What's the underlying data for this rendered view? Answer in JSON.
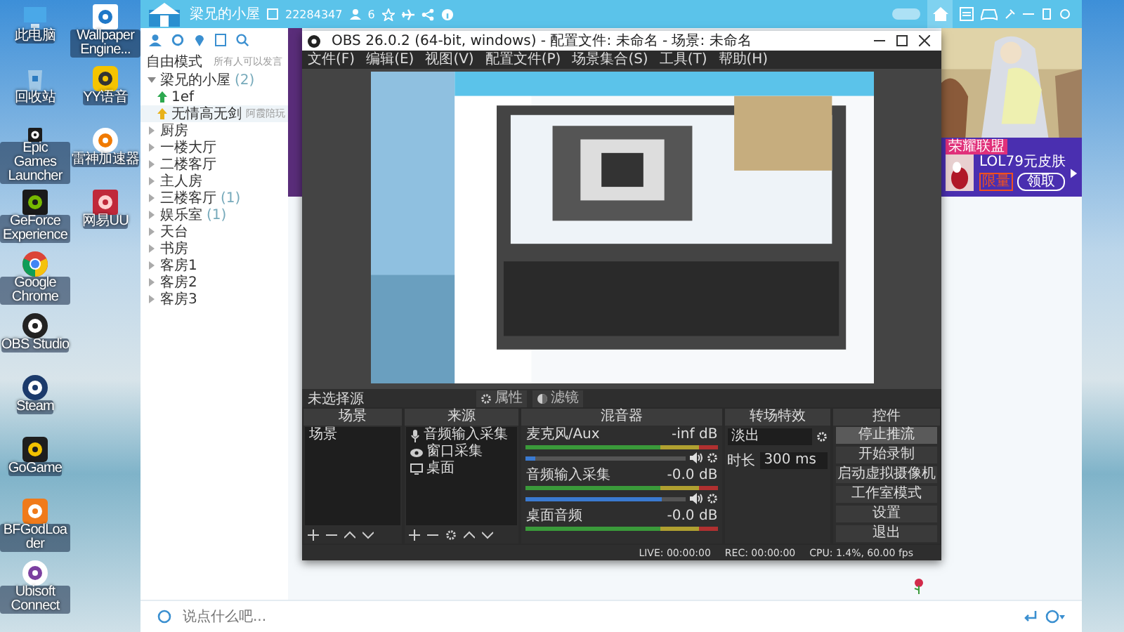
{
  "desktop": {
    "columns": [
      [
        {
          "kind": "pc",
          "label": "此电脑"
        },
        {
          "kind": "bin",
          "label": "回收站"
        },
        {
          "kind": "epic",
          "label": "Epic Games Launcher"
        },
        {
          "kind": "nvidia",
          "label": "GeForce Experience"
        },
        {
          "kind": "chrome",
          "label": "Google Chrome"
        },
        {
          "kind": "obs",
          "label": "OBS Studio"
        },
        {
          "kind": "steam",
          "label": "Steam"
        },
        {
          "kind": "g",
          "label": "GoGame"
        },
        {
          "kind": "orange",
          "label": "BFGodLoader"
        },
        {
          "kind": "ubisoft",
          "label": "Ubisoft Connect"
        }
      ],
      [
        {
          "kind": "wallpaper",
          "label": "Wallpaper Engine..."
        },
        {
          "kind": "yy",
          "label": "YY语音"
        },
        {
          "kind": "swirl",
          "label": "雷神加速器"
        },
        {
          "kind": "red",
          "label": "网易UU"
        }
      ]
    ]
  },
  "chat_app": {
    "room_name": "梁兄的小屋",
    "room_id": "22284347",
    "member_count": "6",
    "mode": "自由模式",
    "mode_note": "所有人可以发言",
    "channels": [
      {
        "label": "梁兄的小屋",
        "count": "(2)",
        "expanded": true,
        "children": [
          {
            "label": "1ef"
          },
          {
            "label": "无情高无剑",
            "tag": "阿霞陪玩"
          }
        ]
      },
      {
        "label": "厨房",
        "expanded": false
      },
      {
        "label": "一楼大厅",
        "expanded": false
      },
      {
        "label": "二楼客厅",
        "expanded": false
      },
      {
        "label": "主人房",
        "expanded": false
      },
      {
        "label": "三楼客厅",
        "count": "(1)",
        "expanded": false
      },
      {
        "label": "娱乐室",
        "count": "(1)",
        "expanded": false
      },
      {
        "label": "天台",
        "expanded": false
      },
      {
        "label": "书房",
        "expanded": false
      },
      {
        "label": "客房1",
        "expanded": false
      },
      {
        "label": "客房2",
        "expanded": false
      },
      {
        "label": "客房3",
        "expanded": false
      }
    ],
    "promo": {
      "badge": "荣耀联盟",
      "title": "LOL79元皮肤",
      "tag": "限量",
      "button": "领取"
    },
    "input": {
      "placeholder": "说点什么吧..."
    }
  },
  "obs": {
    "title": "OBS 26.0.2 (64-bit, windows) - 配置文件: 未命名 - 场景: 未命名",
    "menu": [
      "文件(F)",
      "编辑(E)",
      "视图(V)",
      "配置文件(P)",
      "场景集合(S)",
      "工具(T)",
      "帮助(H)"
    ],
    "source_bar": {
      "label": "未选择源",
      "buttons": [
        "属性",
        "滤镜"
      ]
    },
    "docks": {
      "scenes": "场景",
      "sources": "来源",
      "mixer": "混音器",
      "transitions": "转场特效",
      "controls": "控件"
    },
    "scenes": [
      {
        "label": "场景",
        "selected": false
      }
    ],
    "sources": [
      {
        "kind": "mic",
        "label": "音频输入采集"
      },
      {
        "kind": "window",
        "label": "窗口采集"
      },
      {
        "kind": "monitor",
        "label": "桌面"
      }
    ],
    "mixer": [
      {
        "name": "麦克风/Aux",
        "reading": "-inf dB",
        "level": 0.06
      },
      {
        "name": "音频输入采集",
        "reading": "-0.0 dB",
        "level": 0.85
      },
      {
        "name": "桌面音频",
        "reading": "-0.0 dB"
      }
    ],
    "transition": {
      "value": "淡出",
      "duration_label": "时长",
      "duration": "300 ms"
    },
    "controls": [
      {
        "label": "停止推流",
        "selected": true
      },
      {
        "label": "开始录制",
        "selected": false
      },
      {
        "label": "启动虚拟摄像机",
        "selected": false
      },
      {
        "label": "工作室模式",
        "selected": false
      },
      {
        "label": "设置",
        "selected": false
      },
      {
        "label": "退出",
        "selected": false
      }
    ],
    "status": {
      "live": "LIVE: 00:00:00",
      "rec": "REC: 00:00:00",
      "cpu": "CPU: 1.4%, 60.00 fps"
    }
  }
}
